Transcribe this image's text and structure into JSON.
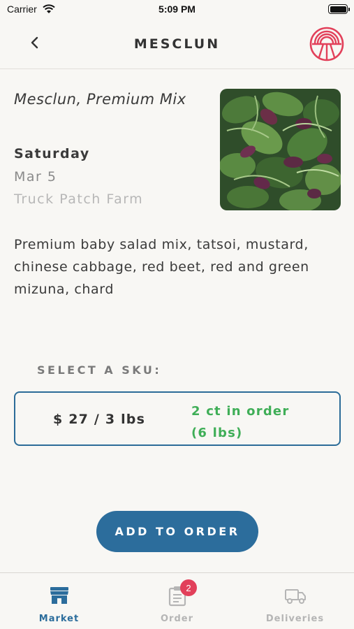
{
  "status_bar": {
    "carrier": "Carrier",
    "time": "5:09 PM"
  },
  "nav": {
    "title": "MESCLUN",
    "back_icon": "chevron-left-icon",
    "logo_icon": "market-logo-icon"
  },
  "product": {
    "name": "Mesclun, Premium Mix",
    "day": "Saturday",
    "date": "Mar 5",
    "farm": "Truck Patch Farm",
    "description": "Premium baby salad mix, tatsoi, mustard, chinese cabbage, red beet, red and green mizuna, chard"
  },
  "sku": {
    "heading": "SELECT A SKU:",
    "options": [
      {
        "price": "$ 27 / 3 lbs",
        "order_count_line1": "2 ct in order",
        "order_count_line2": "(6 lbs)"
      }
    ]
  },
  "actions": {
    "add_to_order": "ADD TO ORDER"
  },
  "tabs": [
    {
      "label": "Market",
      "icon": "storefront-icon",
      "active": true
    },
    {
      "label": "Order",
      "icon": "clipboard-icon",
      "badge": "2",
      "active": false
    },
    {
      "label": "Deliveries",
      "icon": "truck-icon",
      "active": false
    }
  ],
  "colors": {
    "background": "#f8f7f4",
    "accent": "#2c6d9c",
    "success": "#3fae57",
    "badge": "#e2405a",
    "logo": "#e2405a"
  }
}
